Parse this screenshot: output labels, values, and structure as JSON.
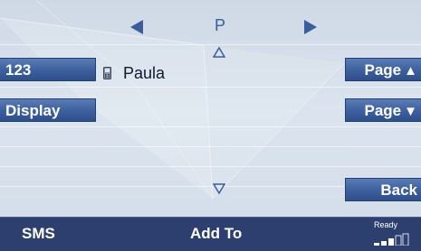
{
  "navigation": {
    "letter": "P",
    "left_arrow_icon": "triangle-left-icon",
    "right_arrow_icon": "triangle-right-icon",
    "scroll_up_icon": "triangle-up-outline-icon",
    "scroll_down_icon": "triangle-down-outline-icon"
  },
  "left_buttons": {
    "numbers_label": "123",
    "display_label": "Display"
  },
  "right_buttons": {
    "page_up_label": "Page",
    "page_up_arrow": "▲",
    "page_down_label": "Page",
    "page_down_arrow": "▼",
    "back_label": "Back"
  },
  "list": {
    "entries": [
      {
        "name": "Paula",
        "icon": "phone-icon"
      }
    ]
  },
  "bottom_bar": {
    "sms_label": "SMS",
    "add_to_label": "Add To",
    "status_label": "Ready",
    "signal_icon": "signal-strength-icon",
    "signal_level": 0.6
  },
  "colors": {
    "accent": "#3a5d9b",
    "button": "#3c5f9e",
    "bottom_bar": "#2c3f6f",
    "background": "#d3dde9"
  }
}
